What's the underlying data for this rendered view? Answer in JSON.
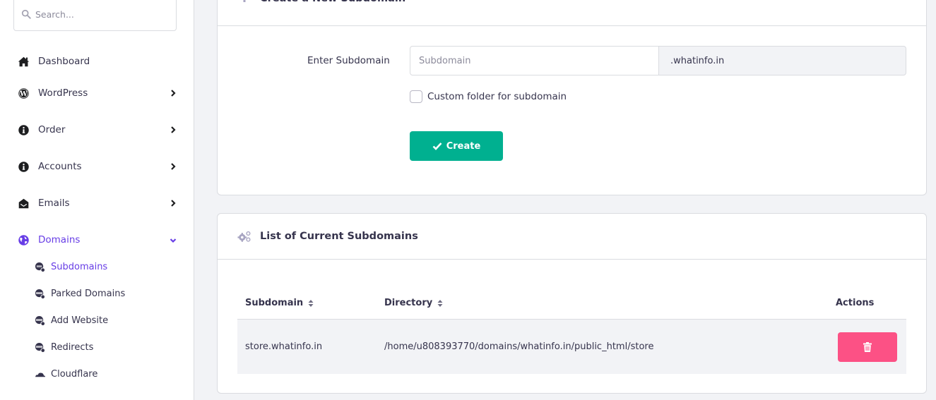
{
  "colors": {
    "accent": "#673de6",
    "success": "#00b090",
    "danger": "#fc5185",
    "text": "#36344d",
    "muted_bg": "#f2f3f6"
  },
  "sidebar": {
    "search": {
      "placeholder": "Search...",
      "icon": "search-icon"
    },
    "items": [
      {
        "label": "Dashboard",
        "icon": "home-icon",
        "has_chevron": false
      },
      {
        "label": "WordPress",
        "icon": "wordpress-icon",
        "has_chevron": true
      },
      {
        "label": "Order",
        "icon": "info-icon",
        "has_chevron": true
      },
      {
        "label": "Accounts",
        "icon": "info-icon",
        "has_chevron": true
      },
      {
        "label": "Emails",
        "icon": "envelope-open-icon",
        "has_chevron": true
      },
      {
        "label": "Domains",
        "icon": "globe-icon",
        "has_chevron": true,
        "expanded": true,
        "active": true
      }
    ],
    "sub_items": [
      {
        "label": "Subdomains",
        "icon": "globe-network-icon",
        "active": true
      },
      {
        "label": "Parked Domains",
        "icon": "globe-network-icon"
      },
      {
        "label": "Add Website",
        "icon": "globe-network-icon"
      },
      {
        "label": "Redirects",
        "icon": "globe-network-icon"
      },
      {
        "label": "Cloudflare",
        "icon": "cloud-icon"
      }
    ]
  },
  "create_card": {
    "title": "Create a New Subdomain",
    "icon": "plus-icon",
    "field_label": "Enter Subdomain",
    "input_placeholder": "Subdomain",
    "input_value": "",
    "suffix": ".whatinfo.in",
    "checkbox_label": "Custom folder for subdomain",
    "checkbox_checked": false,
    "button_label": "Create"
  },
  "list_card": {
    "title": "List of Current Subdomains",
    "icon": "cogs-icon",
    "columns": [
      "Subdomain",
      "Directory",
      "Actions"
    ],
    "rows": [
      {
        "subdomain": "store.whatinfo.in",
        "directory": "/home/u808393770/domains/whatinfo.in/public_html/store"
      }
    ]
  }
}
